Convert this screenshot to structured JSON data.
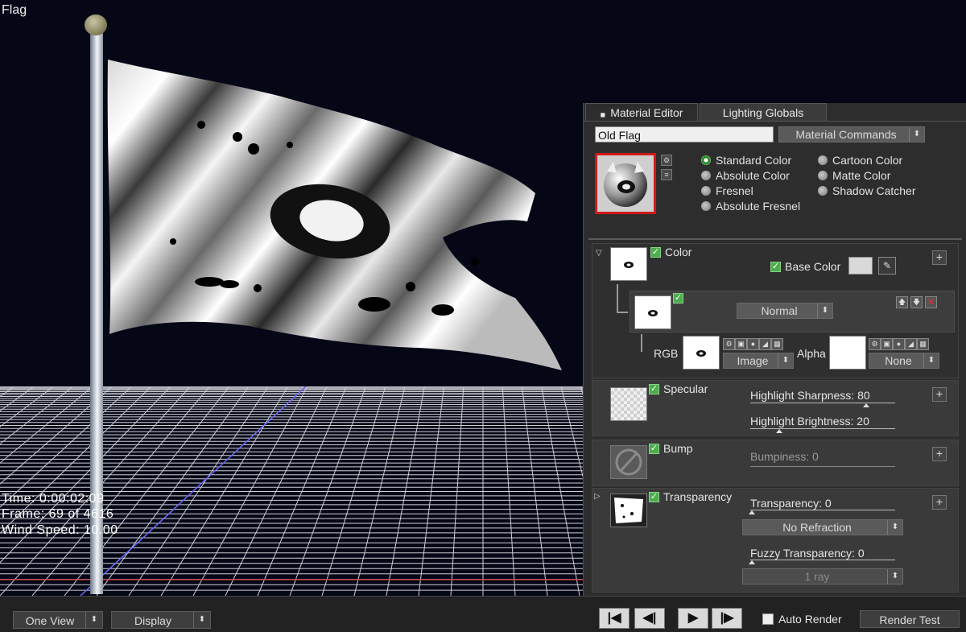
{
  "viewport": {
    "title": "Flag",
    "hud": {
      "time": "Time: 0:00:02:09",
      "frame": "Frame: 69  of  4616",
      "wind": "Wind Speed: 10.00"
    }
  },
  "panel": {
    "tabs": [
      {
        "label": "Material Editor",
        "active": true
      },
      {
        "label": "Lighting Globals",
        "active": false
      }
    ],
    "material_name": "Old Flag",
    "material_commands": "Material Commands",
    "shading_options": [
      {
        "label": "Standard Color",
        "selected": true
      },
      {
        "label": "Absolute Color",
        "selected": false
      },
      {
        "label": "Fresnel",
        "selected": false
      },
      {
        "label": "Absolute Fresnel",
        "selected": false
      },
      {
        "label": "Cartoon Color",
        "selected": false
      },
      {
        "label": "Matte Color",
        "selected": false
      },
      {
        "label": "Shadow Catcher",
        "selected": false
      }
    ],
    "color": {
      "label": "Color",
      "base_color_label": "Base Color",
      "base_color_value": "#d9d9d9",
      "blend_mode": "Normal",
      "rgb_label": "RGB",
      "rgb_source": "Image",
      "alpha_label": "Alpha",
      "alpha_source": "None"
    },
    "specular": {
      "label": "Specular",
      "sharpness": "Highlight Sharpness: 80",
      "sharpness_value": 80,
      "brightness": "Highlight Brightness: 20",
      "brightness_value": 20
    },
    "bump": {
      "label": "Bump",
      "bumpiness": "Bumpiness: 0"
    },
    "transparency": {
      "label": "Transparency",
      "transparency": "Transparency: 0",
      "refraction": "No Refraction",
      "fuzzy": "Fuzzy Transparency: 0",
      "rays": "1 ray"
    }
  },
  "bottombar": {
    "view_mode": "One View",
    "display": "Display",
    "auto_render": "Auto Render",
    "render_test": "Render Test"
  },
  "colors": {
    "panel_bg": "#2d2d2d",
    "viewport_bg": "#050716",
    "check_green": "#4cae4c",
    "preview_border": "#d01818"
  }
}
